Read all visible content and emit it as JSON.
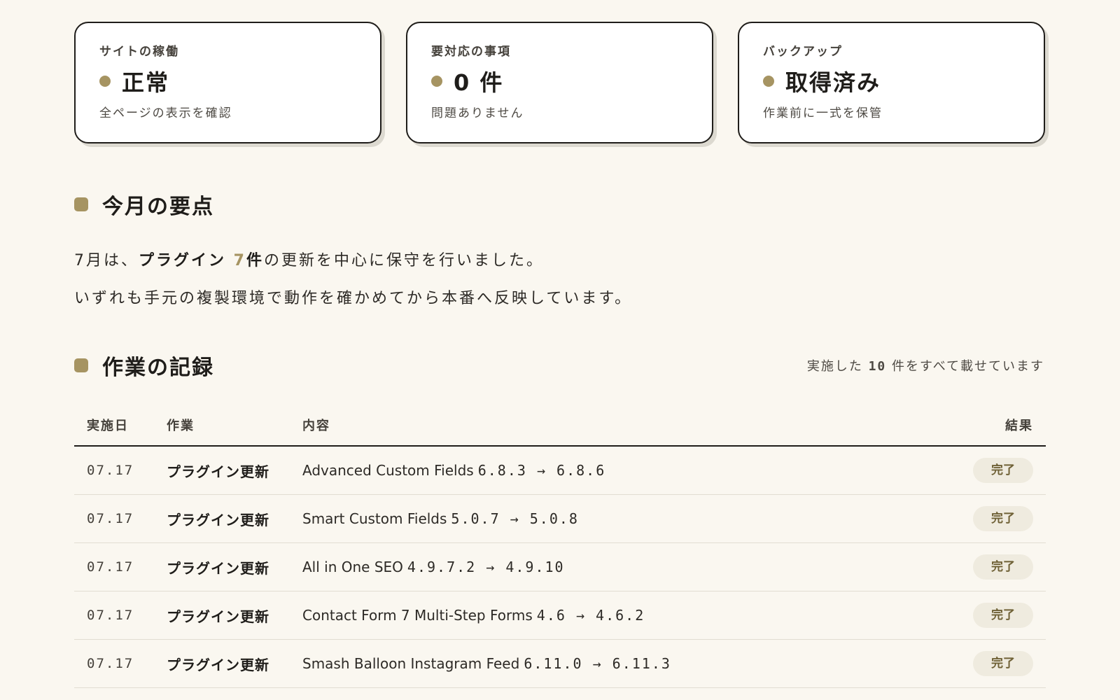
{
  "status_cards": [
    {
      "label": "サイトの稼働",
      "value": "正常",
      "note": "全ページの表示を確認"
    },
    {
      "label": "要対応の事項",
      "value": "0 件",
      "note": "問題ありません"
    },
    {
      "label": "バックアップ",
      "value": "取得済み",
      "note": "作業前に一式を保管"
    }
  ],
  "summary": {
    "title": "今月の要点",
    "line1_prefix": "7月は、",
    "line1_bold": "プラグイン ",
    "line1_accent": "7",
    "line1_bold2": "件",
    "line1_suffix": "の更新を中心に保守を行いました。",
    "line2": "いずれも手元の複製環境で動作を確かめてから本番へ反映しています。"
  },
  "log": {
    "title": "作業の記録",
    "note_prefix": "実施した ",
    "note_count": "10",
    "note_suffix": " 件をすべて載せています",
    "headers": {
      "date": "実施日",
      "work": "作業",
      "content": "内容",
      "result": "結果"
    },
    "rows": [
      {
        "date": "07.17",
        "work": "プラグイン更新",
        "name": "Advanced Custom Fields",
        "version": "6.8.3 → 6.8.6",
        "result": "完了"
      },
      {
        "date": "07.17",
        "work": "プラグイン更新",
        "name": "Smart Custom Fields",
        "version": "5.0.7 → 5.0.8",
        "result": "完了"
      },
      {
        "date": "07.17",
        "work": "プラグイン更新",
        "name": "All in One SEO",
        "version": "4.9.7.2 → 4.9.10",
        "result": "完了"
      },
      {
        "date": "07.17",
        "work": "プラグイン更新",
        "name": "Contact Form 7 Multi-Step Forms",
        "version": "4.6 → 4.6.2",
        "result": "完了"
      },
      {
        "date": "07.17",
        "work": "プラグイン更新",
        "name": "Smash Balloon Instagram Feed",
        "version": "6.11.0 → 6.11.3",
        "result": "完了"
      }
    ]
  },
  "colors": {
    "background": "#faf7f0",
    "accent": "#a69462",
    "text": "#1f1d1a",
    "badge_bg": "#efebdf"
  }
}
